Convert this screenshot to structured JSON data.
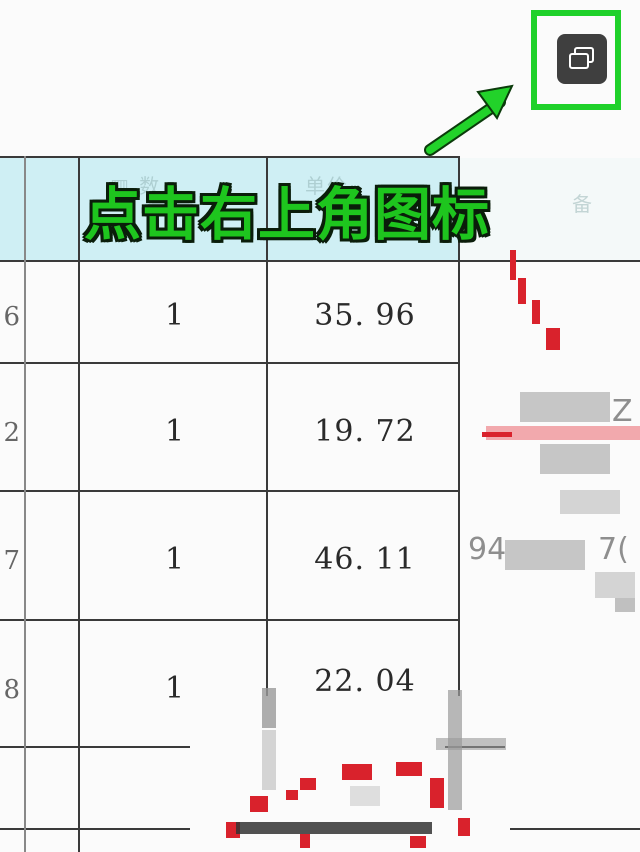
{
  "instruction_overlay": {
    "text": "点击右上角图标"
  },
  "restore_button": {
    "icon": "restore-window-icon",
    "bg_color": "#3f3f3f"
  },
  "highlight": {
    "box_color": "#1fd12a",
    "arrow_color": "#1fd12a"
  },
  "table": {
    "header_bg": "#cfeff4",
    "rows": [
      {
        "left_partial": "6",
        "qty": "1",
        "price": "35. 96"
      },
      {
        "left_partial": "2",
        "qty": "1",
        "price": "19. 72"
      },
      {
        "left_partial": "7",
        "qty": "1",
        "price": "46. 11"
      },
      {
        "left_partial": "8",
        "qty": "1",
        "price": "22. 04"
      }
    ]
  },
  "right_blurred": {
    "line1": "Z",
    "line2": "94",
    "line3": "7("
  }
}
